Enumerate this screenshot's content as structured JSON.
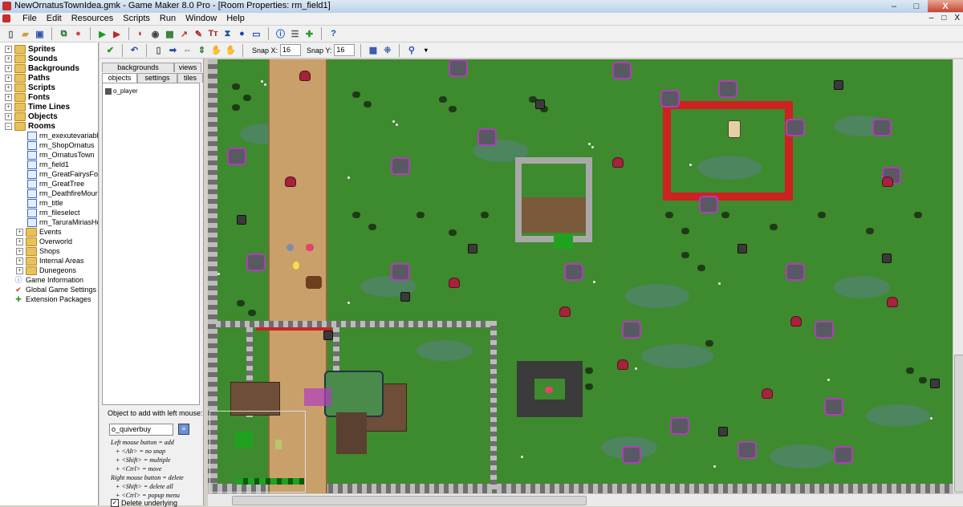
{
  "window": {
    "title": "NewOrnatusTownIdea.gmk - Game Maker 8.0 Pro - [Room Properties: rm_field1]",
    "buttons": [
      "–",
      "□",
      "X"
    ]
  },
  "menu": {
    "items": [
      "File",
      "Edit",
      "Resources",
      "Scripts",
      "Run",
      "Window",
      "Help"
    ],
    "mdi_buttons": [
      "–",
      "□",
      "X"
    ]
  },
  "tree": {
    "top_folders": [
      "Sprites",
      "Sounds",
      "Backgrounds",
      "Paths",
      "Scripts",
      "Fonts",
      "Time Lines",
      "Objects",
      "Rooms"
    ],
    "rooms": [
      "rm_exexutevariables",
      "rm_ShopOrnatus",
      "rm_OrnatusTown",
      "rm_field1",
      "rm_GreatFairysFoun",
      "rm_GreatTree",
      "rm_DeathfireMounta",
      "rm_title",
      "rm_fileselect",
      "rm_TaruraMiriasHou"
    ],
    "room_groups": [
      "Events",
      "Overworld",
      "Shops",
      "Internal Areas",
      "Dunegeons"
    ],
    "misc": [
      "Game Information",
      "Global Game Settings",
      "Extension Packages"
    ]
  },
  "room_toolbar": {
    "snap_x_label": "Snap X:",
    "snap_x_value": "16",
    "snap_y_label": "Snap Y:",
    "snap_y_value": "16"
  },
  "panel": {
    "tabs_top": [
      "backgrounds",
      "views"
    ],
    "tabs_bottom": [
      "objects",
      "settings",
      "tiles"
    ],
    "object_entry": "o_player",
    "add_label": "Object to add with left mouse:",
    "object_field": "o_quiverbuy",
    "help_lines": [
      "Left mouse button = add",
      "+ <Alt> = no snap",
      "+ <Shift> = multiple",
      "+ <Ctrl> = move",
      "Right mouse button = delete",
      "+ <Shift> = delete all",
      "+ <Ctrl> = popup menu"
    ],
    "delete_underlying": "Delete underlying"
  },
  "colors": {
    "grass": "#3e8a2e",
    "path": "#c9a06a",
    "fence": "#cc2222",
    "stump_border": "#b23cbb"
  }
}
